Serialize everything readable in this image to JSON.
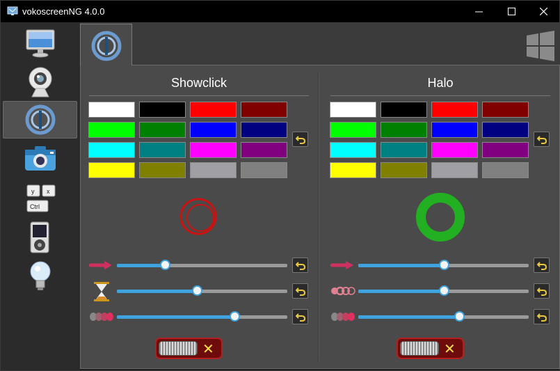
{
  "window": {
    "title": "vokoscreenNG 4.0.0"
  },
  "controls": {
    "minimize": "—",
    "maximize": "☐",
    "close": "✕"
  },
  "sidebar": {
    "items": [
      {
        "name": "screencast",
        "icon": "monitor-icon"
      },
      {
        "name": "camera",
        "icon": "webcam-icon"
      },
      {
        "name": "showclick",
        "icon": "showclick-icon",
        "active": true
      },
      {
        "name": "snapshot",
        "icon": "photo-camera-icon"
      },
      {
        "name": "hotkeys",
        "icon": "keyboard-icon",
        "keys": [
          "y",
          "x",
          "Ctrl"
        ]
      },
      {
        "name": "player",
        "icon": "media-player-icon"
      },
      {
        "name": "about",
        "icon": "lightbulb-icon"
      }
    ]
  },
  "showclick": {
    "title": "Showclick",
    "selected_color": "#cc1111",
    "sliders": [
      {
        "name": "size",
        "value": 0.28
      },
      {
        "name": "duration",
        "value": 0.47
      },
      {
        "name": "opacity",
        "value": 0.69
      }
    ],
    "enabled": false
  },
  "halo": {
    "title": "Halo",
    "selected_color": "#22b022",
    "sliders": [
      {
        "name": "size",
        "value": 0.5
      },
      {
        "name": "transparency",
        "value": 0.5
      },
      {
        "name": "opacity",
        "value": 0.59
      }
    ],
    "enabled": false
  },
  "palette": [
    "#ffffff",
    "#000000",
    "#ff0000",
    "#800000",
    "#00ff00",
    "#008000",
    "#0000ff",
    "#000080",
    "#00ffff",
    "#008080",
    "#ff00ff",
    "#800080",
    "#ffff00",
    "#808000",
    "#a0a0a4",
    "#808080"
  ]
}
